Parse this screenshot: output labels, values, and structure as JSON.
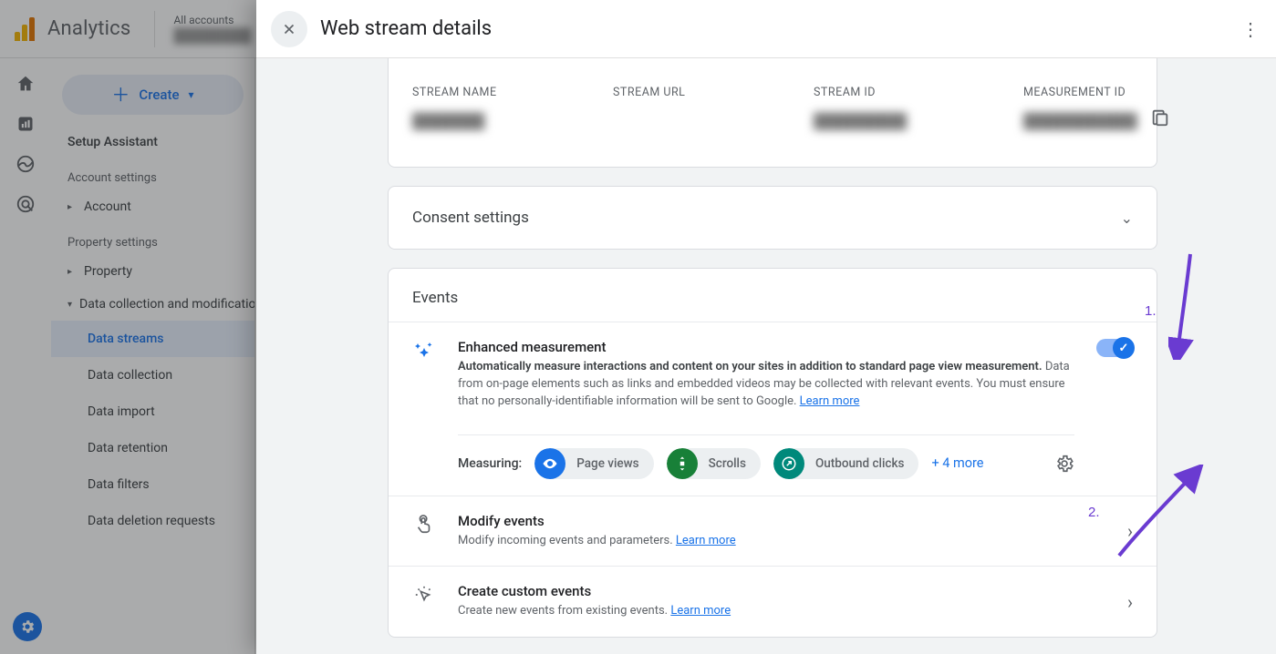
{
  "app": {
    "title": "Analytics",
    "account_switch_label": "All accounts",
    "account_switch_value": "████████"
  },
  "sidebar": {
    "create_label": "Create",
    "setup_assistant": "Setup Assistant",
    "account_settings_heading": "Account settings",
    "account_item": "Account",
    "property_settings_heading": "Property settings",
    "property_item": "Property",
    "data_collection_item": "Data collection and modification",
    "subitems": {
      "data_streams": "Data streams",
      "data_collection": "Data collection",
      "data_import": "Data import",
      "data_retention": "Data retention",
      "data_filters": "Data filters",
      "data_deletion": "Data deletion requests"
    }
  },
  "panel": {
    "title": "Web stream details",
    "stream_info": {
      "stream_name_label": "STREAM NAME",
      "stream_name_value": "███████",
      "stream_url_label": "STREAM URL",
      "stream_url_value": "",
      "stream_id_label": "STREAM ID",
      "stream_id_value": "█████████",
      "measurement_id_label": "MEASUREMENT ID",
      "measurement_id_value": "███████████"
    },
    "consent": {
      "title": "Consent settings"
    },
    "events_section_title": "Events",
    "enhanced": {
      "title": "Enhanced measurement",
      "bold_intro": "Automatically measure interactions and content on your sites in addition to standard page view measurement.",
      "desc_rest": " Data from on-page elements such as links and embedded videos may be collected with relevant events. You must ensure that no personally-identifiable information will be sent to Google. ",
      "learn_more": "Learn more",
      "measuring_label": "Measuring:",
      "chips": {
        "page_views": "Page views",
        "scrolls": "Scrolls",
        "outbound": "Outbound clicks"
      },
      "more": "+ 4 more"
    },
    "modify_events": {
      "title": "Modify events",
      "desc": "Modify incoming events and parameters. ",
      "learn_more": "Learn more"
    },
    "custom_events": {
      "title": "Create custom events",
      "desc": "Create new events from existing events. ",
      "learn_more": "Learn more"
    }
  },
  "annotations": {
    "one": "1.",
    "two": "2."
  }
}
